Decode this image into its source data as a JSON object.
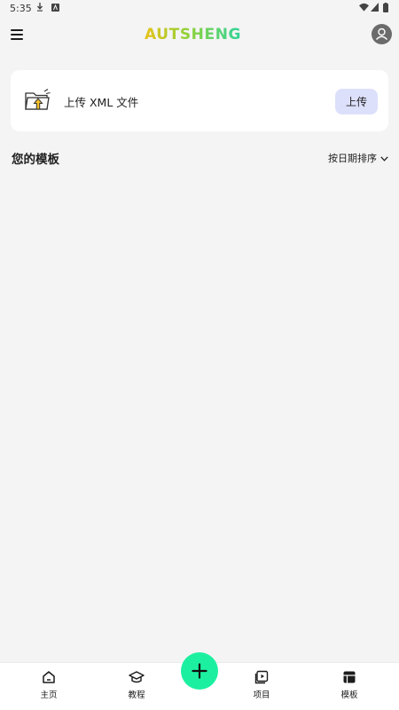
{
  "status_bar": {
    "time": "5:35",
    "icons": [
      "download-icon",
      "notification-icon",
      "wifi-icon",
      "signal-icon",
      "battery-icon"
    ]
  },
  "app_bar": {
    "brand": "AUTSHENG",
    "brand_colors": {
      "accent_yellow": "#e8c21a",
      "accent_green": "#33d17a"
    },
    "menu_icon": "hamburger-menu-icon",
    "profile_icon": "account-avatar-icon"
  },
  "upload_card": {
    "label": "上传 XML 文件",
    "button_label": "上传",
    "icon": "folder-upload-icon"
  },
  "templates": {
    "title": "您的模板",
    "sort_label": "按日期排序"
  },
  "bottom_nav": {
    "items": [
      {
        "label": "主页",
        "icon": "home-icon"
      },
      {
        "label": "教程",
        "icon": "graduation-cap-icon"
      },
      {
        "label": "项目",
        "icon": "project-video-icon"
      },
      {
        "label": "模板",
        "icon": "template-icon",
        "active": true
      }
    ],
    "fab_icon": "plus-icon"
  },
  "colors": {
    "background": "#f4f4f4",
    "fab": "#1cf0a0",
    "upload_button_bg": "#dde0fb"
  }
}
